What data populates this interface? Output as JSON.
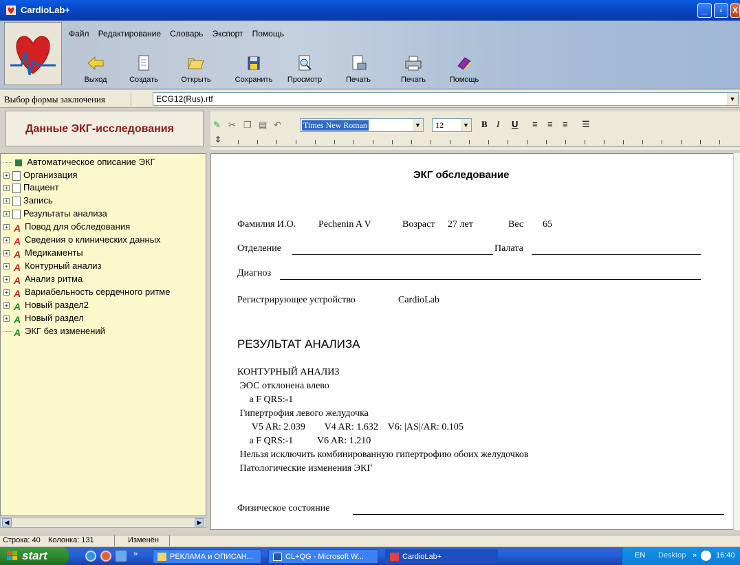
{
  "window": {
    "title": "CardioLab+"
  },
  "menu": [
    "Файл",
    "Редактирование",
    "Словарь",
    "Экспорт",
    "Помощь"
  ],
  "toolbar": [
    {
      "label": "Выход",
      "icon": "arrow-left-icon"
    },
    {
      "label": "Создать",
      "icon": "new-document-icon"
    },
    {
      "label": "Открыть",
      "icon": "open-folder-icon"
    },
    {
      "label": "Сохранить",
      "icon": "save-icon"
    },
    {
      "label": "Просмотр",
      "icon": "preview-icon"
    },
    {
      "label": "Печать",
      "icon": "print-document-icon"
    },
    {
      "label": "Печать",
      "icon": "printer-icon"
    },
    {
      "label": "Помощь",
      "icon": "help-book-icon"
    }
  ],
  "form_select": {
    "label": "Выбор формы заключения",
    "value": "ECG12(Rus).rtf"
  },
  "left_panel": {
    "header": "Данные  ЭКГ-исследования"
  },
  "format_bar": {
    "font": "Times New Roman",
    "size": "12"
  },
  "tree": [
    {
      "label": "Автоматическое описание ЭКГ",
      "icon": "green-square",
      "expandable": false
    },
    {
      "label": "Организация",
      "icon": "doc",
      "expandable": true
    },
    {
      "label": "Пациент",
      "icon": "doc",
      "expandable": true
    },
    {
      "label": "Запись",
      "icon": "doc",
      "expandable": true
    },
    {
      "label": "Результаты анализа",
      "icon": "doc",
      "expandable": true
    },
    {
      "label": "Повод для обследования",
      "icon": "red-a",
      "expandable": true
    },
    {
      "label": "Сведения о клинических данных",
      "icon": "red-a",
      "expandable": true
    },
    {
      "label": "Медикаменты",
      "icon": "red-a",
      "expandable": true
    },
    {
      "label": "Контурный анализ",
      "icon": "red-a",
      "expandable": true
    },
    {
      "label": "Анализ ритма",
      "icon": "red-a",
      "expandable": true
    },
    {
      "label": "Вариабельность сердечного ритме",
      "icon": "red-a",
      "expandable": true
    },
    {
      "label": "Новый раздел2",
      "icon": "green-a",
      "expandable": true
    },
    {
      "label": "Новый раздел",
      "icon": "green-a",
      "expandable": true
    },
    {
      "label": "ЭКГ без изменений",
      "icon": "green-a",
      "expandable": false
    }
  ],
  "document": {
    "title": "ЭКГ обследование",
    "name_label": "Фамилия И.О.",
    "name_value": "Pechenin A V",
    "age_label": "Возраст",
    "age_value": "27 лет",
    "weight_label": "Вес",
    "weight_value": "65",
    "dept_label": "Отделение",
    "ward_label": "Палата",
    "diagnosis_label": "Диагноз",
    "device_label": "Регистрирующее устройство",
    "device_value": "CardioLab",
    "result_title": "РЕЗУЛЬТАТ АНАЛИЗА",
    "lines": [
      "КОНТУРНЫЙ АНАЛИЗ",
      " ЭОС отклонена влево",
      "     a F QRS:-1",
      " Гипертрофия левого желудочка",
      "      V5 AR: 2.039        V4 AR: 1.632    V6: |AS|/AR: 0.105",
      "     a F QRS:-1          V6 AR: 1.210",
      " Нельзя исключить комбинированную гипертрофию обоих желудочков",
      " Патологические изменения ЭКГ"
    ],
    "physical_label": "Физическое состояние"
  },
  "status": {
    "row": "Строка: 40",
    "col": "Колонка: 131",
    "state": "Изменён"
  },
  "taskbar": {
    "start": "start",
    "tasks": [
      "РЕКЛАМА и ОПИСАН...",
      "CL+QG - Microsoft W...",
      "CardioLab+"
    ],
    "lang": "EN",
    "desktop": "Desktop",
    "clock": "16:40"
  }
}
